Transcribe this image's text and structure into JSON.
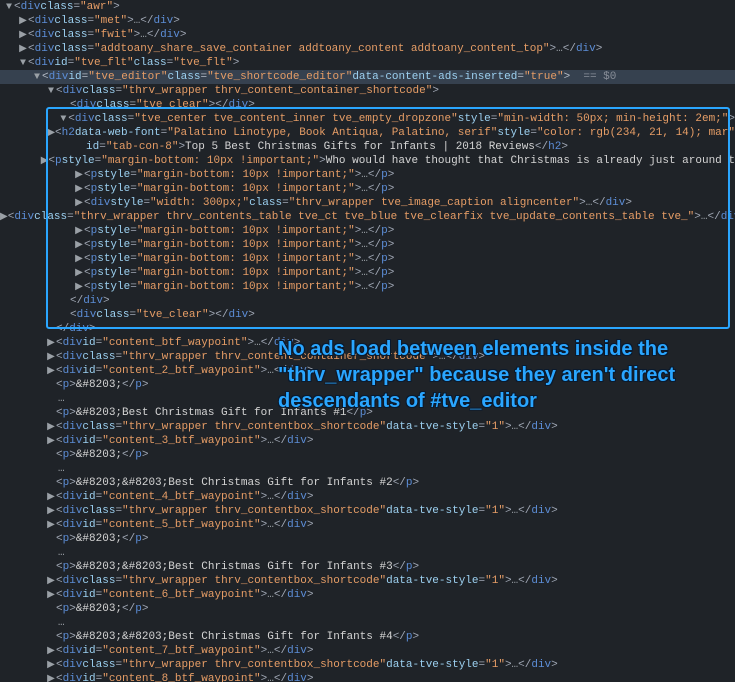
{
  "annotation_text": "No ads load between elements inside the \"thrv_wrapper\" because they aren't direct descendants of #tve_editor",
  "selected_marker": "== $0",
  "lines": [
    {
      "indent": 0,
      "arrow": "▼",
      "type": "open",
      "tag": "div",
      "attrs": [
        [
          "class",
          "awr"
        ]
      ]
    },
    {
      "indent": 1,
      "arrow": "▶",
      "type": "openclose",
      "tag": "div",
      "attrs": [
        [
          "class",
          "met"
        ]
      ]
    },
    {
      "indent": 1,
      "arrow": "▶",
      "type": "openclose",
      "tag": "div",
      "attrs": [
        [
          "class",
          "fwit"
        ]
      ]
    },
    {
      "indent": 1,
      "arrow": "▶",
      "type": "openclose",
      "tag": "div",
      "attrs": [
        [
          "class",
          "addtoany_share_save_container addtoany_content addtoany_content_top"
        ]
      ]
    },
    {
      "indent": 1,
      "arrow": "▼",
      "type": "open",
      "tag": "div",
      "attrs": [
        [
          "id",
          "tve_flt"
        ],
        [
          "class",
          "tve_flt"
        ]
      ]
    },
    {
      "indent": 2,
      "arrow": "▼",
      "type": "open",
      "tag": "div",
      "attrs": [
        [
          "id",
          "tve_editor"
        ],
        [
          "class",
          "tve_shortcode_editor"
        ],
        [
          "data-content-ads-inserted",
          "true"
        ]
      ],
      "selected": true
    },
    {
      "indent": 3,
      "arrow": "▼",
      "type": "open",
      "tag": "div",
      "attrs": [
        [
          "class",
          "thrv_wrapper thrv_content_container_shortcode"
        ]
      ]
    },
    {
      "indent": 4,
      "arrow": "",
      "type": "empty",
      "tag": "div",
      "attrs": [
        [
          "class",
          "tve_clear"
        ]
      ]
    },
    {
      "indent": 4,
      "arrow": "▼",
      "type": "open",
      "tag": "div",
      "attrs": [
        [
          "class",
          "tve_center tve_content_inner tve_empty_dropzone"
        ],
        [
          "style",
          "min-width: 50px; min-height: 2em;"
        ]
      ]
    },
    {
      "indent": 5,
      "arrow": "▶",
      "type": "h2",
      "tag": "h2",
      "attrs": [
        [
          "data-web-font",
          "Palatino Linotype, Book Antiqua, Palatino, serif"
        ],
        [
          "style",
          "color: rgb(234, 21, 14); mar"
        ]
      ],
      "cont": true
    },
    {
      "indent": 5,
      "arrow": "",
      "type": "contline",
      "text_attr": [
        [
          "id",
          "tab-con-8"
        ]
      ],
      "text": "Top 5 Best Christmas Gifts for Infants | 2018 Reviews",
      "closeTag": "h2"
    },
    {
      "indent": 5,
      "arrow": "▶",
      "type": "pinline",
      "tag": "p",
      "attrs": [
        [
          "style",
          "margin-bottom: 10px !important;"
        ]
      ],
      "text": "Who would have thought that Christmas is already just around t",
      "trunc": true
    },
    {
      "indent": 5,
      "arrow": "▶",
      "type": "openclose",
      "tag": "p",
      "attrs": [
        [
          "style",
          "margin-bottom: 10px !important;"
        ]
      ]
    },
    {
      "indent": 5,
      "arrow": "▶",
      "type": "openclose",
      "tag": "p",
      "attrs": [
        [
          "style",
          "margin-bottom: 10px !important;"
        ]
      ]
    },
    {
      "indent": 5,
      "arrow": "▶",
      "type": "openclose",
      "tag": "div",
      "attrs": [
        [
          "style",
          "width: 300px;"
        ],
        [
          "class",
          "thrv_wrapper tve_image_caption aligncenter"
        ]
      ]
    },
    {
      "indent": 5,
      "arrow": "▶",
      "type": "openclose",
      "tag": "div",
      "attrs": [
        [
          "class",
          "thrv_wrapper thrv_contents_table tve_ct tve_blue tve_clearfix tve_update_contents_table tve_"
        ]
      ],
      "trunc": true
    },
    {
      "indent": 5,
      "arrow": "▶",
      "type": "openclose",
      "tag": "p",
      "attrs": [
        [
          "style",
          "margin-bottom: 10px !important;"
        ]
      ]
    },
    {
      "indent": 5,
      "arrow": "▶",
      "type": "openclose",
      "tag": "p",
      "attrs": [
        [
          "style",
          "margin-bottom: 10px !important;"
        ]
      ]
    },
    {
      "indent": 5,
      "arrow": "▶",
      "type": "openclose",
      "tag": "p",
      "attrs": [
        [
          "style",
          "margin-bottom: 10px !important;"
        ]
      ]
    },
    {
      "indent": 5,
      "arrow": "▶",
      "type": "openclose",
      "tag": "p",
      "attrs": [
        [
          "style",
          "margin-bottom: 10px !important;"
        ]
      ]
    },
    {
      "indent": 5,
      "arrow": "▶",
      "type": "openclose",
      "tag": "p",
      "attrs": [
        [
          "style",
          "margin-bottom: 10px !important;"
        ]
      ]
    },
    {
      "indent": 4,
      "arrow": "",
      "type": "close",
      "tag": "div"
    },
    {
      "indent": 4,
      "arrow": "",
      "type": "empty",
      "tag": "div",
      "attrs": [
        [
          "class",
          "tve_clear"
        ]
      ]
    },
    {
      "indent": 3,
      "arrow": "",
      "type": "close",
      "tag": "div"
    },
    {
      "indent": 3,
      "arrow": "▶",
      "type": "openclose",
      "tag": "div",
      "attrs": [
        [
          "id",
          "content_btf_waypoint"
        ]
      ]
    },
    {
      "indent": 3,
      "arrow": "▶",
      "type": "openclose",
      "tag": "div",
      "attrs": [
        [
          "class",
          "thrv_wrapper thrv_content_container_shortcode"
        ]
      ]
    },
    {
      "indent": 3,
      "arrow": "▶",
      "type": "openclose",
      "tag": "div",
      "attrs": [
        [
          "id",
          "content_2_btf_waypoint"
        ]
      ]
    },
    {
      "indent": 3,
      "arrow": "",
      "type": "pinline",
      "tag": "p",
      "text": "&#8203;"
    },
    {
      "indent": 3,
      "arrow": "",
      "type": "dotsline"
    },
    {
      "indent": 3,
      "arrow": "",
      "type": "pinline",
      "tag": "p",
      "text": "&#8203;Best Christmas Gift for Infants #1"
    },
    {
      "indent": 3,
      "arrow": "▶",
      "type": "openclose",
      "tag": "div",
      "attrs": [
        [
          "class",
          "thrv_wrapper thrv_contentbox_shortcode"
        ],
        [
          "data-tve-style",
          "1"
        ]
      ]
    },
    {
      "indent": 3,
      "arrow": "▶",
      "type": "openclose",
      "tag": "div",
      "attrs": [
        [
          "id",
          "content_3_btf_waypoint"
        ]
      ]
    },
    {
      "indent": 3,
      "arrow": "",
      "type": "pinline",
      "tag": "p",
      "text": "&#8203;"
    },
    {
      "indent": 3,
      "arrow": "",
      "type": "dotsline"
    },
    {
      "indent": 3,
      "arrow": "",
      "type": "pinline",
      "tag": "p",
      "text": "&#8203;&#8203;Best Christmas Gift for Infants #2"
    },
    {
      "indent": 3,
      "arrow": "▶",
      "type": "openclose",
      "tag": "div",
      "attrs": [
        [
          "id",
          "content_4_btf_waypoint"
        ]
      ]
    },
    {
      "indent": 3,
      "arrow": "▶",
      "type": "openclose",
      "tag": "div",
      "attrs": [
        [
          "class",
          "thrv_wrapper thrv_contentbox_shortcode"
        ],
        [
          "data-tve-style",
          "1"
        ]
      ]
    },
    {
      "indent": 3,
      "arrow": "▶",
      "type": "openclose",
      "tag": "div",
      "attrs": [
        [
          "id",
          "content_5_btf_waypoint"
        ]
      ]
    },
    {
      "indent": 3,
      "arrow": "",
      "type": "pinline",
      "tag": "p",
      "text": "&#8203;"
    },
    {
      "indent": 3,
      "arrow": "",
      "type": "dotsline"
    },
    {
      "indent": 3,
      "arrow": "",
      "type": "pinline",
      "tag": "p",
      "text": "&#8203;&#8203;Best Christmas Gift for Infants #3"
    },
    {
      "indent": 3,
      "arrow": "▶",
      "type": "openclose",
      "tag": "div",
      "attrs": [
        [
          "class",
          "thrv_wrapper thrv_contentbox_shortcode"
        ],
        [
          "data-tve-style",
          "1"
        ]
      ]
    },
    {
      "indent": 3,
      "arrow": "▶",
      "type": "openclose",
      "tag": "div",
      "attrs": [
        [
          "id",
          "content_6_btf_waypoint"
        ]
      ]
    },
    {
      "indent": 3,
      "arrow": "",
      "type": "pinline",
      "tag": "p",
      "text": "&#8203;"
    },
    {
      "indent": 3,
      "arrow": "",
      "type": "dotsline"
    },
    {
      "indent": 3,
      "arrow": "",
      "type": "pinline",
      "tag": "p",
      "text": "&#8203;&#8203;Best Christmas Gift for Infants #4"
    },
    {
      "indent": 3,
      "arrow": "▶",
      "type": "openclose",
      "tag": "div",
      "attrs": [
        [
          "id",
          "content_7_btf_waypoint"
        ]
      ]
    },
    {
      "indent": 3,
      "arrow": "▶",
      "type": "openclose",
      "tag": "div",
      "attrs": [
        [
          "class",
          "thrv_wrapper thrv_contentbox_shortcode"
        ],
        [
          "data-tve-style",
          "1"
        ]
      ]
    },
    {
      "indent": 3,
      "arrow": "▶",
      "type": "openclose",
      "tag": "div",
      "attrs": [
        [
          "id",
          "content_8_btf_waypoint"
        ]
      ]
    }
  ]
}
